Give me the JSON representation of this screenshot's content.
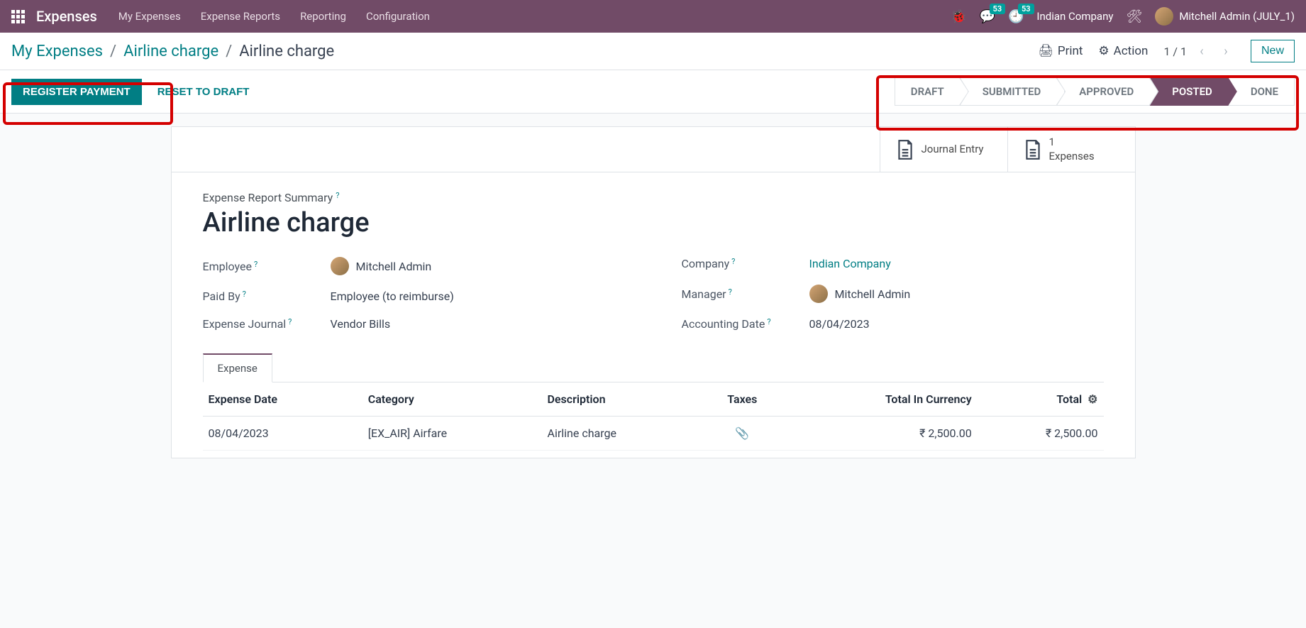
{
  "navbar": {
    "brand": "Expenses",
    "menu": [
      "My Expenses",
      "Expense Reports",
      "Reporting",
      "Configuration"
    ],
    "msg_badge": "53",
    "activity_badge": "53",
    "company": "Indian Company",
    "user": "Mitchell Admin (JULY_1)"
  },
  "breadcrumb": {
    "root": "My Expenses",
    "mid": "Airline charge",
    "current": "Airline charge"
  },
  "controls": {
    "print": "Print",
    "action": "Action",
    "pager": "1 / 1",
    "new": "New"
  },
  "buttons": {
    "register": "REGISTER PAYMENT",
    "reset": "RESET TO DRAFT"
  },
  "steps": [
    "DRAFT",
    "SUBMITTED",
    "APPROVED",
    "POSTED",
    "DONE"
  ],
  "active_step": 3,
  "stats": {
    "journal": "Journal Entry",
    "exp_count": "1",
    "exp_label": "Expenses"
  },
  "form": {
    "summary_label": "Expense Report Summary",
    "title": "Airline charge",
    "labels": {
      "employee": "Employee",
      "paid_by": "Paid By",
      "journal": "Expense Journal",
      "company": "Company",
      "manager": "Manager",
      "acc_date": "Accounting Date"
    },
    "values": {
      "employee": "Mitchell Admin",
      "paid_by": "Employee (to reimburse)",
      "journal": "Vendor Bills",
      "company": "Indian Company",
      "manager": "Mitchell Admin",
      "acc_date": "08/04/2023"
    }
  },
  "tab": {
    "expense": "Expense"
  },
  "table": {
    "headers": {
      "date": "Expense Date",
      "category": "Category",
      "desc": "Description",
      "taxes": "Taxes",
      "total_cur": "Total In Currency",
      "total": "Total"
    },
    "row": {
      "date": "08/04/2023",
      "category": "[EX_AIR] Airfare",
      "desc": "Airline charge",
      "total_cur": "₹ 2,500.00",
      "total": "₹ 2,500.00"
    }
  }
}
